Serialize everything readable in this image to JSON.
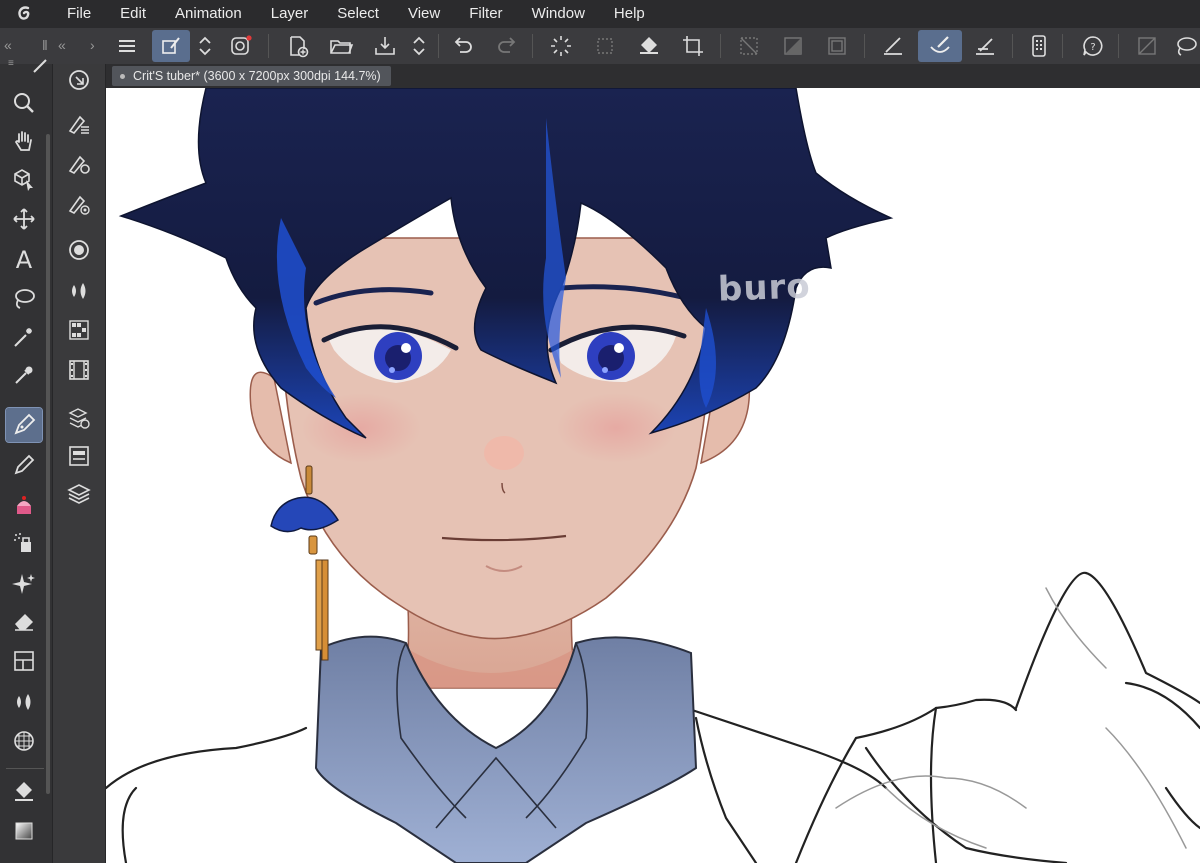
{
  "menubar": {
    "items": [
      "File",
      "Edit",
      "Animation",
      "Layer",
      "Select",
      "View",
      "Filter",
      "Window",
      "Help"
    ]
  },
  "toolbar": {
    "icons": [
      "menu-icon",
      "selection-tool-icon",
      "expand-collapse-icon",
      "record-icon",
      "new-canvas-icon",
      "open-folder-icon",
      "save-icon",
      "expand-collapse-icon",
      "undo-icon",
      "redo-icon",
      "loading-icon",
      "transform-select-icon",
      "fill-icon",
      "crop-icon",
      "clear-selection-icon",
      "invert-selection-icon",
      "stroke-selection-icon",
      "pen-angle-icon",
      "brush-smudge-icon",
      "ruler-pen-icon",
      "device-icon",
      "help-icon",
      "hide-icon",
      "lasso-icon"
    ]
  },
  "tools": [
    "zoom-icon",
    "hand-icon",
    "object-icon",
    "move-icon",
    "text-icon",
    "lasso-icon",
    "magic-wand-icon",
    "eyedropper-icon",
    "pen-icon",
    "pencil-icon",
    "cake-brush-icon",
    "airbrush-icon",
    "sparkle-icon",
    "eraser-icon",
    "frame-icon",
    "blend-icon",
    "grid-ruler-icon",
    "fill-bucket-icon",
    "gradient-icon"
  ],
  "subtools": [
    "navigator-icon",
    "layer-property-icon",
    "sub-tool-detail-icon",
    "tool-property-icon",
    "color-circle-icon",
    "color-mix-icon",
    "color-set-icon",
    "animation-timeline-icon",
    "material-icon",
    "layer-list-icon",
    "layers-icon"
  ],
  "document": {
    "tab_title": "Crit'S tuber* (3600 x 7200px 300dpi 144.7%)"
  },
  "canvas": {
    "watermark": "buro"
  },
  "colors": {
    "menubar": "#2b2b2d",
    "toolbar": "#3b3b3e",
    "active": "#5a6e8e",
    "hair": "#16214a",
    "hair_highlight": "#1e4fd0",
    "skin": "#e7c3b4",
    "collar": "#8fa2c9"
  }
}
